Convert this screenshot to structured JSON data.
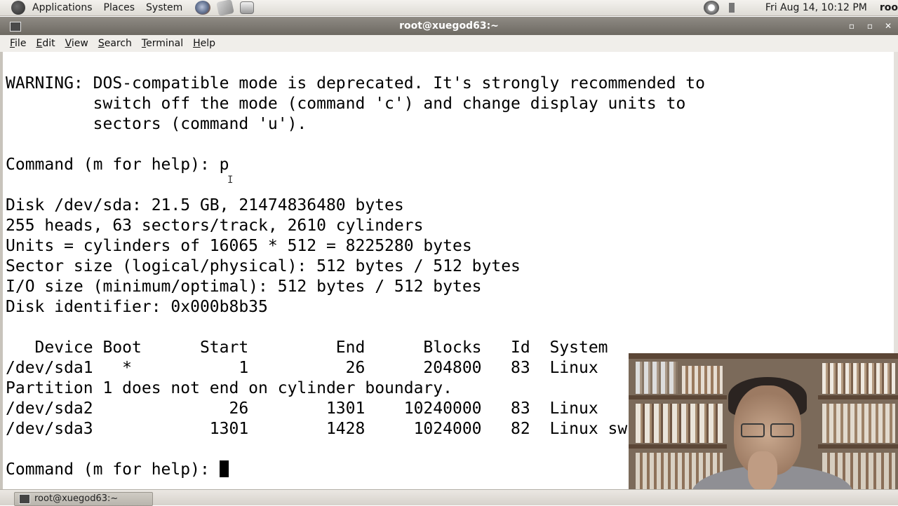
{
  "panel": {
    "menus": [
      "Applications",
      "Places",
      "System"
    ],
    "clock": "Fri Aug 14, 10:12 PM",
    "user": "roo"
  },
  "window": {
    "title": "root@xuegod63:~",
    "buttons": [
      "▫",
      "▫",
      "✕"
    ]
  },
  "menubar": {
    "items": [
      {
        "accel": "F",
        "rest": "ile"
      },
      {
        "accel": "E",
        "rest": "dit"
      },
      {
        "accel": "V",
        "rest": "iew"
      },
      {
        "accel": "S",
        "rest": "earch"
      },
      {
        "accel": "T",
        "rest": "erminal"
      },
      {
        "accel": "H",
        "rest": "elp"
      }
    ]
  },
  "terminal": {
    "lines": [
      "WARNING: DOS-compatible mode is deprecated. It's strongly recommended to",
      "         switch off the mode (command 'c') and change display units to",
      "         sectors (command 'u').",
      "",
      "Command (m for help): p",
      "",
      "Disk /dev/sda: 21.5 GB, 21474836480 bytes",
      "255 heads, 63 sectors/track, 2610 cylinders",
      "Units = cylinders of 16065 * 512 = 8225280 bytes",
      "Sector size (logical/physical): 512 bytes / 512 bytes",
      "I/O size (minimum/optimal): 512 bytes / 512 bytes",
      "Disk identifier: 0x000b8b35",
      "",
      "   Device Boot      Start         End      Blocks   Id  System",
      "/dev/sda1   *           1          26      204800   83  Linux",
      "Partition 1 does not end on cylinder boundary.",
      "/dev/sda2              26        1301    10240000   83  Linux",
      "/dev/sda3            1301        1428     1024000   82  Linux sw",
      ""
    ],
    "prompt": "Command (m for help): "
  },
  "taskbar": {
    "task_label": "root@xuegod63:~"
  }
}
